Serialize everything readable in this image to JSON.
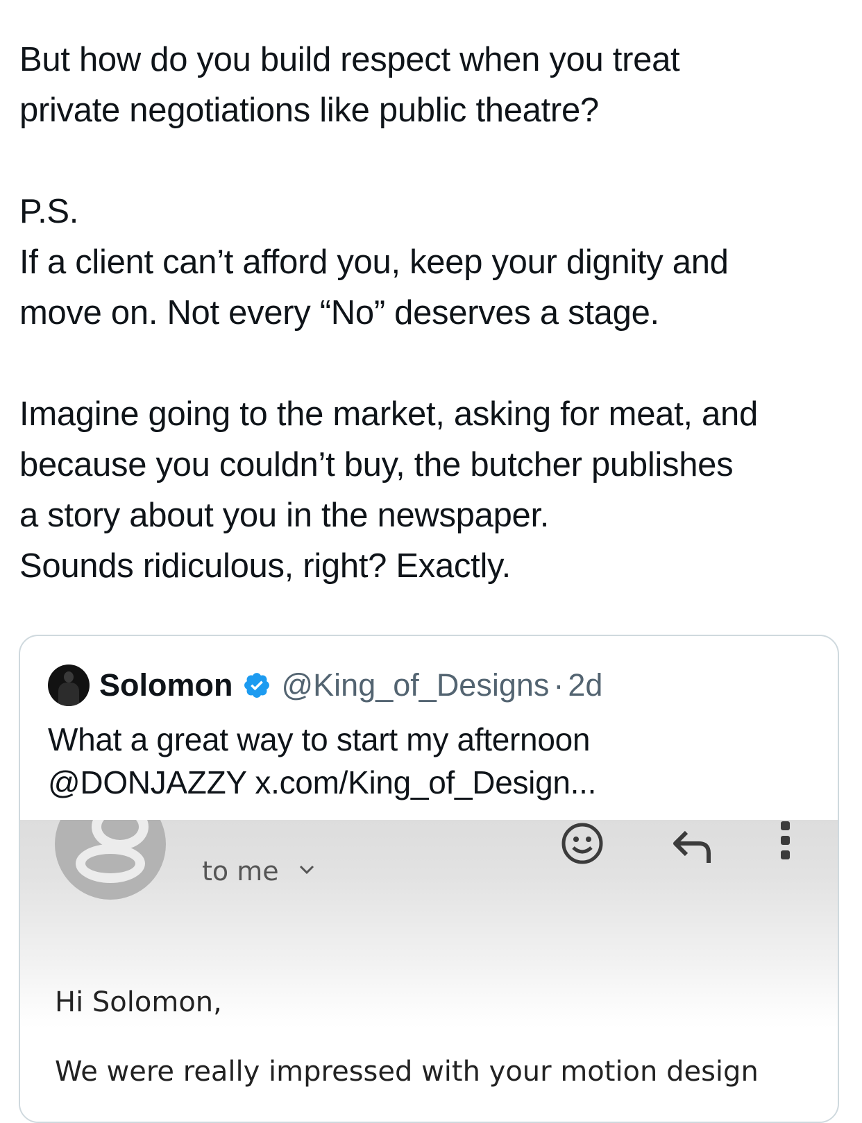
{
  "tweet": {
    "lines": [
      "But how do you build respect when you treat",
      "private negotiations like public theatre?",
      "",
      "P.S.",
      "If a client can’t afford you, keep your dignity and",
      "move on. Not every “No” deserves a stage.",
      "",
      "Imagine going to the market, asking for meat, and",
      "because you couldn’t buy, the butcher publishes",
      "a story about you in the newspaper.",
      "Sounds ridiculous, right? Exactly."
    ]
  },
  "quote": {
    "name": "Solomon",
    "handle": "@King_of_Designs",
    "separator": "·",
    "time": "2d",
    "text_line1": "What a great way to start my afternoon",
    "text_line2": "@DONJAZZY x.com/King_of_Design...",
    "verified_color": "#1d9bf0"
  },
  "email": {
    "to_me": "to me",
    "greeting": "Hi Solomon,",
    "body_line": "We were really impressed with your motion design"
  }
}
